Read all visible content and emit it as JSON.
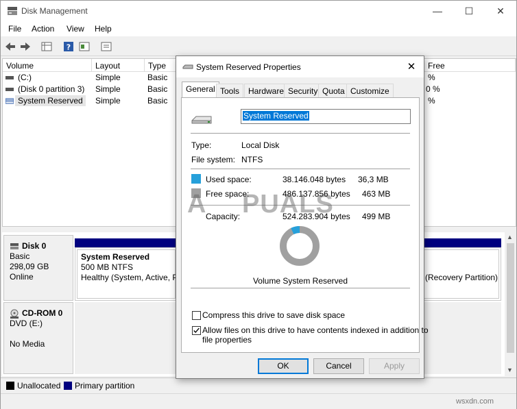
{
  "window": {
    "title": "Disk Management",
    "minimize": "—",
    "maximize": "☐",
    "close": "✕"
  },
  "menu": [
    "File",
    "Action",
    "View",
    "Help"
  ],
  "volume_list": {
    "columns": [
      "Volume",
      "Layout",
      "Type",
      "Free"
    ],
    "rows": [
      {
        "volume": "(C:)",
        "layout": "Simple",
        "type": "Basic",
        "free": "%"
      },
      {
        "volume": "(Disk 0 partition 3)",
        "layout": "Simple",
        "type": "Basic",
        "free": "0 %"
      },
      {
        "volume": "System Reserved",
        "layout": "Simple",
        "type": "Basic",
        "free": "%"
      }
    ]
  },
  "disks": [
    {
      "name": "Disk 0",
      "line1": "Basic",
      "line2": "298,09 GB",
      "line3": "Online"
    },
    {
      "name": "CD-ROM 0",
      "line1": "DVD (E:)",
      "line2": "",
      "line3": "No Media"
    }
  ],
  "partition": {
    "name": "System Reserved",
    "size": "500 MB NTFS",
    "status": "Healthy (System, Active, P",
    "right_status": "(Recovery Partition)"
  },
  "legend": [
    {
      "label": "Unallocated",
      "color": "#000000"
    },
    {
      "label": "Primary partition",
      "color": "#00007f"
    }
  ],
  "dialog": {
    "title": "System Reserved Properties",
    "close": "✕",
    "tabs": [
      "General",
      "Tools",
      "Hardware",
      "Security",
      "Quota",
      "Customize"
    ],
    "name_value": "System Reserved",
    "type_label": "Type:",
    "type_value": "Local Disk",
    "fs_label": "File system:",
    "fs_value": "NTFS",
    "used": {
      "label": "Used space:",
      "bytes": "38.146.048 bytes",
      "size": "36,3 MB",
      "color": "#26a0da"
    },
    "free": {
      "label": "Free space:",
      "bytes": "486.137.856 bytes",
      "size": "463 MB",
      "color": "#a0a0a0"
    },
    "capacity": {
      "label": "Capacity:",
      "bytes": "524.283.904 bytes",
      "size": "499 MB"
    },
    "used_fraction": 0.0728,
    "volume_caption": "Volume System Reserved",
    "compress_label": "Compress this drive to save disk space",
    "compress_checked": false,
    "index_label_1": "Allow files on this drive to have contents indexed in addition to",
    "index_label_2": "file properties",
    "index_checked": true,
    "ok": "OK",
    "cancel": "Cancel",
    "apply": "Apply"
  },
  "watermark": {
    "text_a": "A",
    "text_b": "PUALS",
    "site": "wsxdn.com"
  }
}
